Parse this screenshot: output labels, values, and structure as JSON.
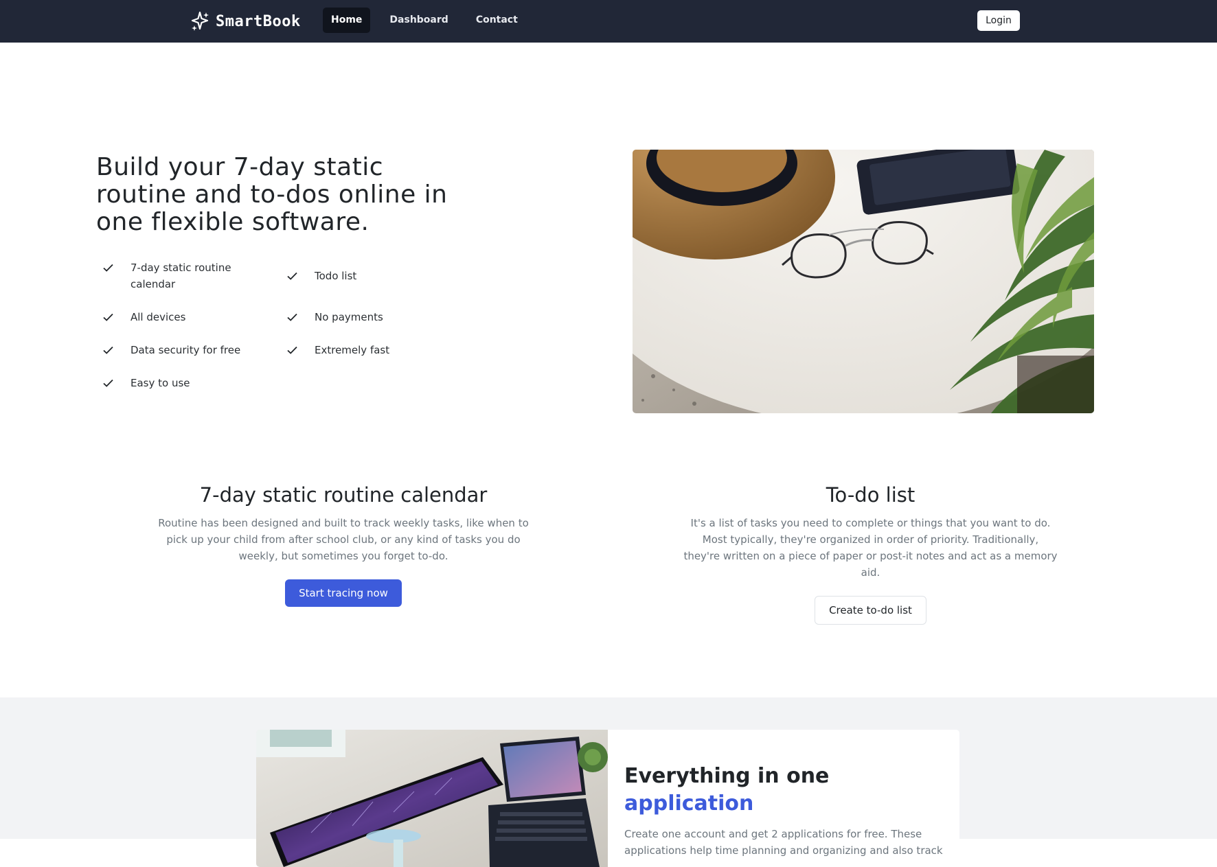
{
  "navbar": {
    "brand": "SmartBook",
    "brand_icon": "sparkle-icon",
    "links": [
      "Home",
      "Dashboard",
      "Contact"
    ],
    "login": "Login"
  },
  "hero": {
    "title": "Build your 7-day static routine and to-dos online in one flexible software.",
    "features": [
      "7-day static routine calendar",
      "Todo list",
      "All devices",
      "No payments",
      "Data security for free",
      "Extremely fast",
      "Easy to use"
    ],
    "check_icon": "checkmark-icon",
    "image": "hat-glasses-plant-photo"
  },
  "routine": {
    "title": "7-day static routine calendar",
    "text": "Routine has been designed and built to track weekly tasks, like when to pick up your child from after school club, or any kind of tasks you do weekly, but sometimes you forget to-do.",
    "button": "Start tracing now"
  },
  "todo": {
    "title": "To-do list",
    "text": "It's a list of tasks you need to complete or things that you want to do. Most typically, they're organized in order of priority. Traditionally, they're written on a piece of paper or post-it notes and act as a memory aid.",
    "button": "Create to-do list"
  },
  "everything": {
    "title_plain": "Everything in one",
    "title_accent": "application",
    "text": "Create one account and get 2 applications for free. These applications help time planning and organizing and also track",
    "image": "monitor-laptop-desk-photo"
  },
  "colors": {
    "navbar": "#212737",
    "accent": "#3d5bdb",
    "section_bg": "#f2f3f5"
  }
}
